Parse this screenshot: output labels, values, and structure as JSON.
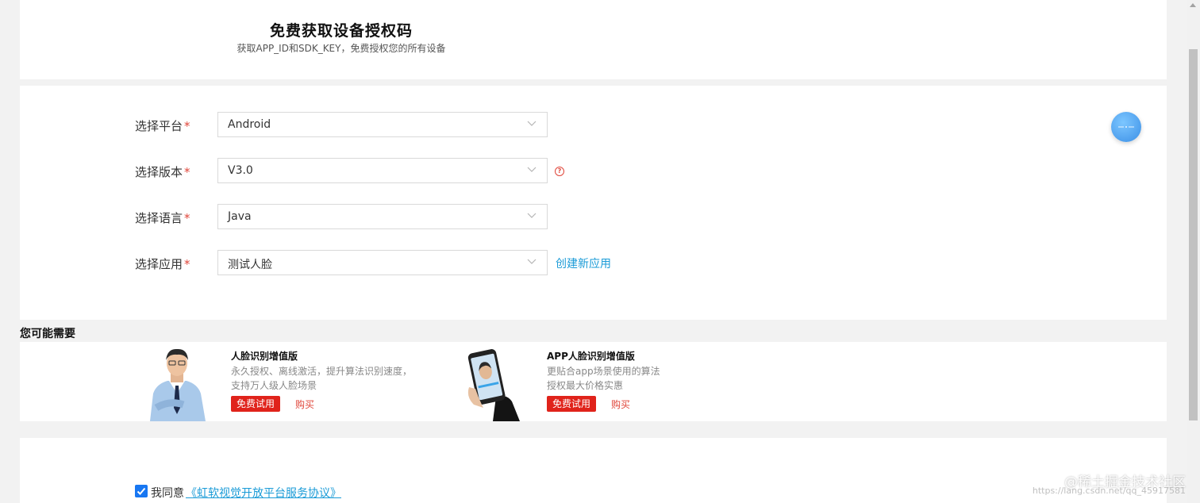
{
  "header": {
    "title": "免费获取设备授权码",
    "subtitle": "获取APP_ID和SDK_KEY，免费授权您的所有设备"
  },
  "form": {
    "required_mark": "*",
    "platform": {
      "label": "选择平台",
      "value": "Android"
    },
    "version": {
      "label": "选择版本",
      "value": "V3.0",
      "help": "?"
    },
    "language": {
      "label": "选择语言",
      "value": "Java"
    },
    "app": {
      "label": "选择应用",
      "value": "测试人脸",
      "create_link": "创建新应用"
    }
  },
  "recommend": {
    "title": "您可能需要",
    "products": [
      {
        "name": "人脸识别增值版",
        "desc_line1": "永久授权、离线激活，提升算法识别速度，",
        "desc_line2": "支持万人级人脸场景",
        "trial": "免费试用",
        "buy": "购买"
      },
      {
        "name": "APP人脸识别增值版",
        "desc_line1": "更贴合app场景使用的算法",
        "desc_line2": "授权最大价格实惠",
        "trial": "免费试用",
        "buy": "购买"
      }
    ]
  },
  "agreement": {
    "prefix": "我同意",
    "link": "《虹软视觉开放平台服务协议》",
    "checked": true
  },
  "watermark": {
    "text": "@稀土掘金技术社区",
    "url": "https://lang.csdn.net/qq_45917581"
  },
  "icons": {
    "dropdown": "chevron-down-icon",
    "help": "question-circle-icon",
    "check": "check-icon",
    "floating": "assistant-icon"
  },
  "colors": {
    "accent_link": "#1a9bd7",
    "required": "#e0463a",
    "trial_button": "#e0231b",
    "checkbox": "#1877f2"
  }
}
